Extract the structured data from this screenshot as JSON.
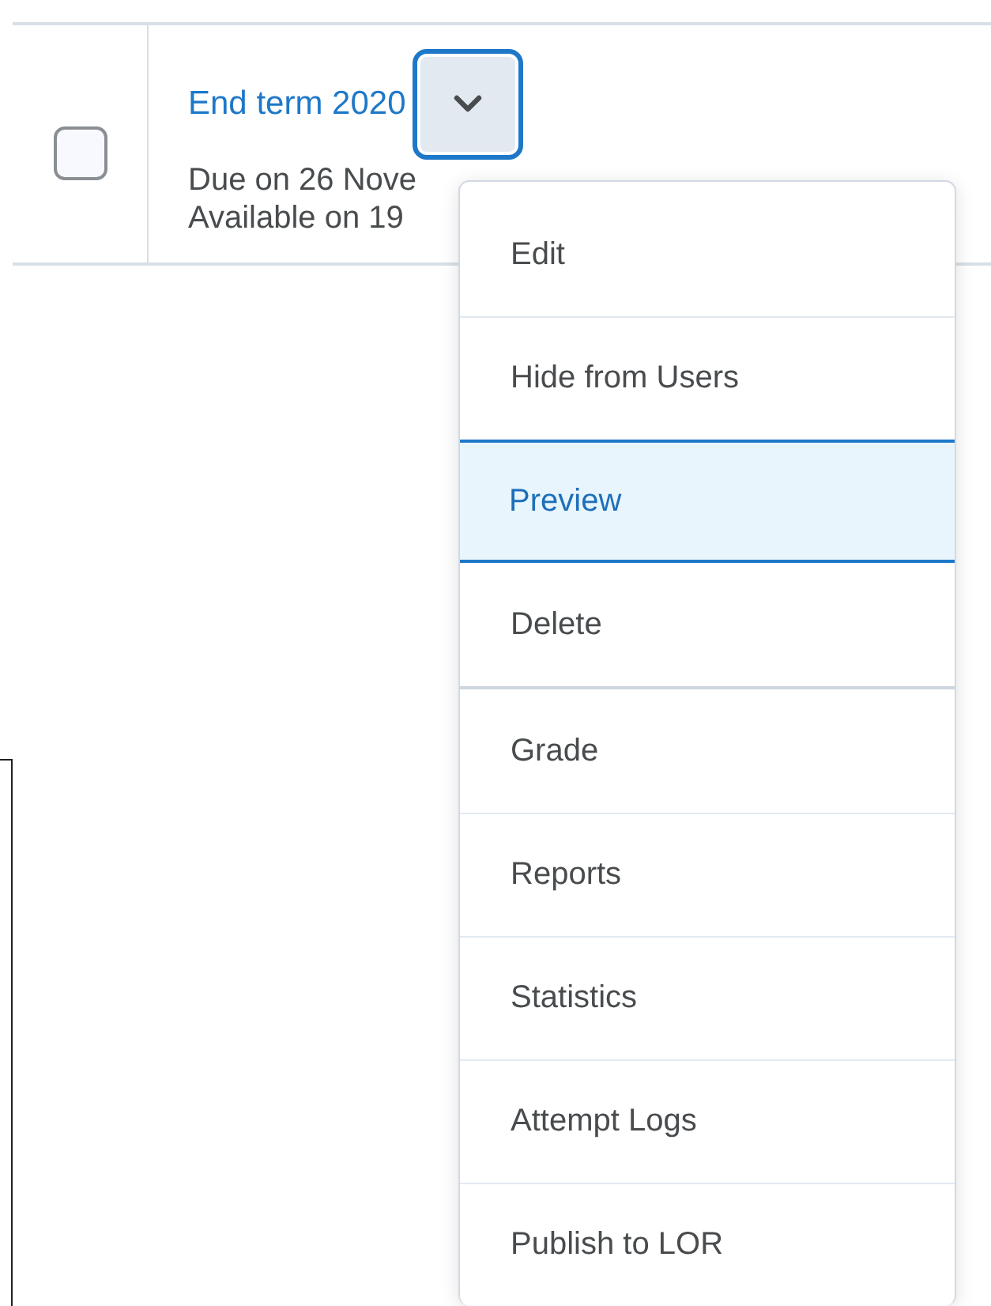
{
  "row": {
    "checkbox": {
      "checked": false
    },
    "title": "End term 2020",
    "menu_button": {
      "expanded": true
    },
    "due": "Due on 26 Nove",
    "available": "Available on 19"
  },
  "menu": {
    "groups": [
      [
        {
          "label": "Edit",
          "selected": false
        },
        {
          "label": "Hide from Users",
          "selected": false
        },
        {
          "label": "Preview",
          "selected": true
        },
        {
          "label": "Delete",
          "selected": false
        }
      ],
      [
        {
          "label": "Grade",
          "selected": false
        },
        {
          "label": "Reports",
          "selected": false
        },
        {
          "label": "Statistics",
          "selected": false
        },
        {
          "label": "Attempt Logs",
          "selected": false
        },
        {
          "label": "Publish to LOR",
          "selected": false
        }
      ]
    ]
  }
}
